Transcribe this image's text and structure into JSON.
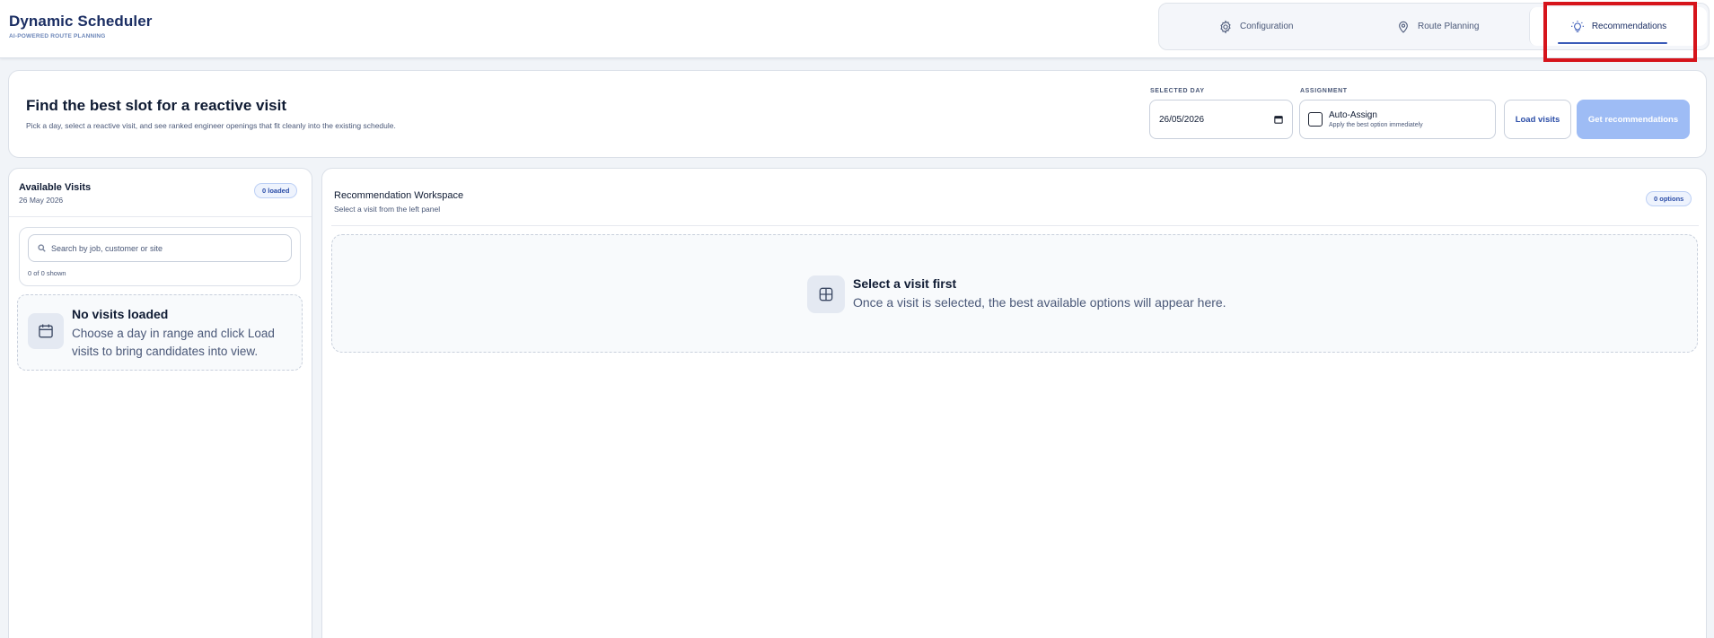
{
  "app": {
    "title": "Dynamic Scheduler",
    "subtitle": "AI-POWERED ROUTE PLANNING"
  },
  "nav": {
    "items": [
      {
        "label": "Configuration",
        "icon": "gear-icon"
      },
      {
        "label": "Route Planning",
        "icon": "map-pin-icon"
      },
      {
        "label": "Recommendations",
        "icon": "lightbulb-icon",
        "active": true
      }
    ]
  },
  "finder": {
    "title": "Find the best slot for a reactive visit",
    "description": "Pick a day, select a reactive visit, and see ranked engineer openings that fit cleanly into the existing schedule.",
    "selected_day_label": "SELECTED DAY",
    "selected_day_value": "26/05/2026",
    "assignment_label": "ASSIGNMENT",
    "auto_assign_label": "Auto-Assign",
    "auto_assign_sub": "Apply the best option immediately",
    "load_button": "Load visits",
    "reco_button": "Get recommendations"
  },
  "visits": {
    "title": "Available Visits",
    "date": "26 May 2026",
    "badge": "0 loaded",
    "search_placeholder": "Search by job, customer or site",
    "shown": "0 of 0 shown",
    "empty_title": "No visits loaded",
    "empty_text": "Choose a day in range and click Load visits to bring candidates into view."
  },
  "workspace": {
    "title": "Recommendation Workspace",
    "subtitle": "Select a visit from the left panel",
    "badge": "0 options",
    "empty_title": "Select a visit first",
    "empty_text": "Once a visit is selected, the best available options will appear here."
  },
  "colors": {
    "brand": "#1b2e63",
    "accent": "#3a5bb8",
    "primary_button_disabled": "#9ebcf5",
    "highlight": "#d6141b"
  }
}
